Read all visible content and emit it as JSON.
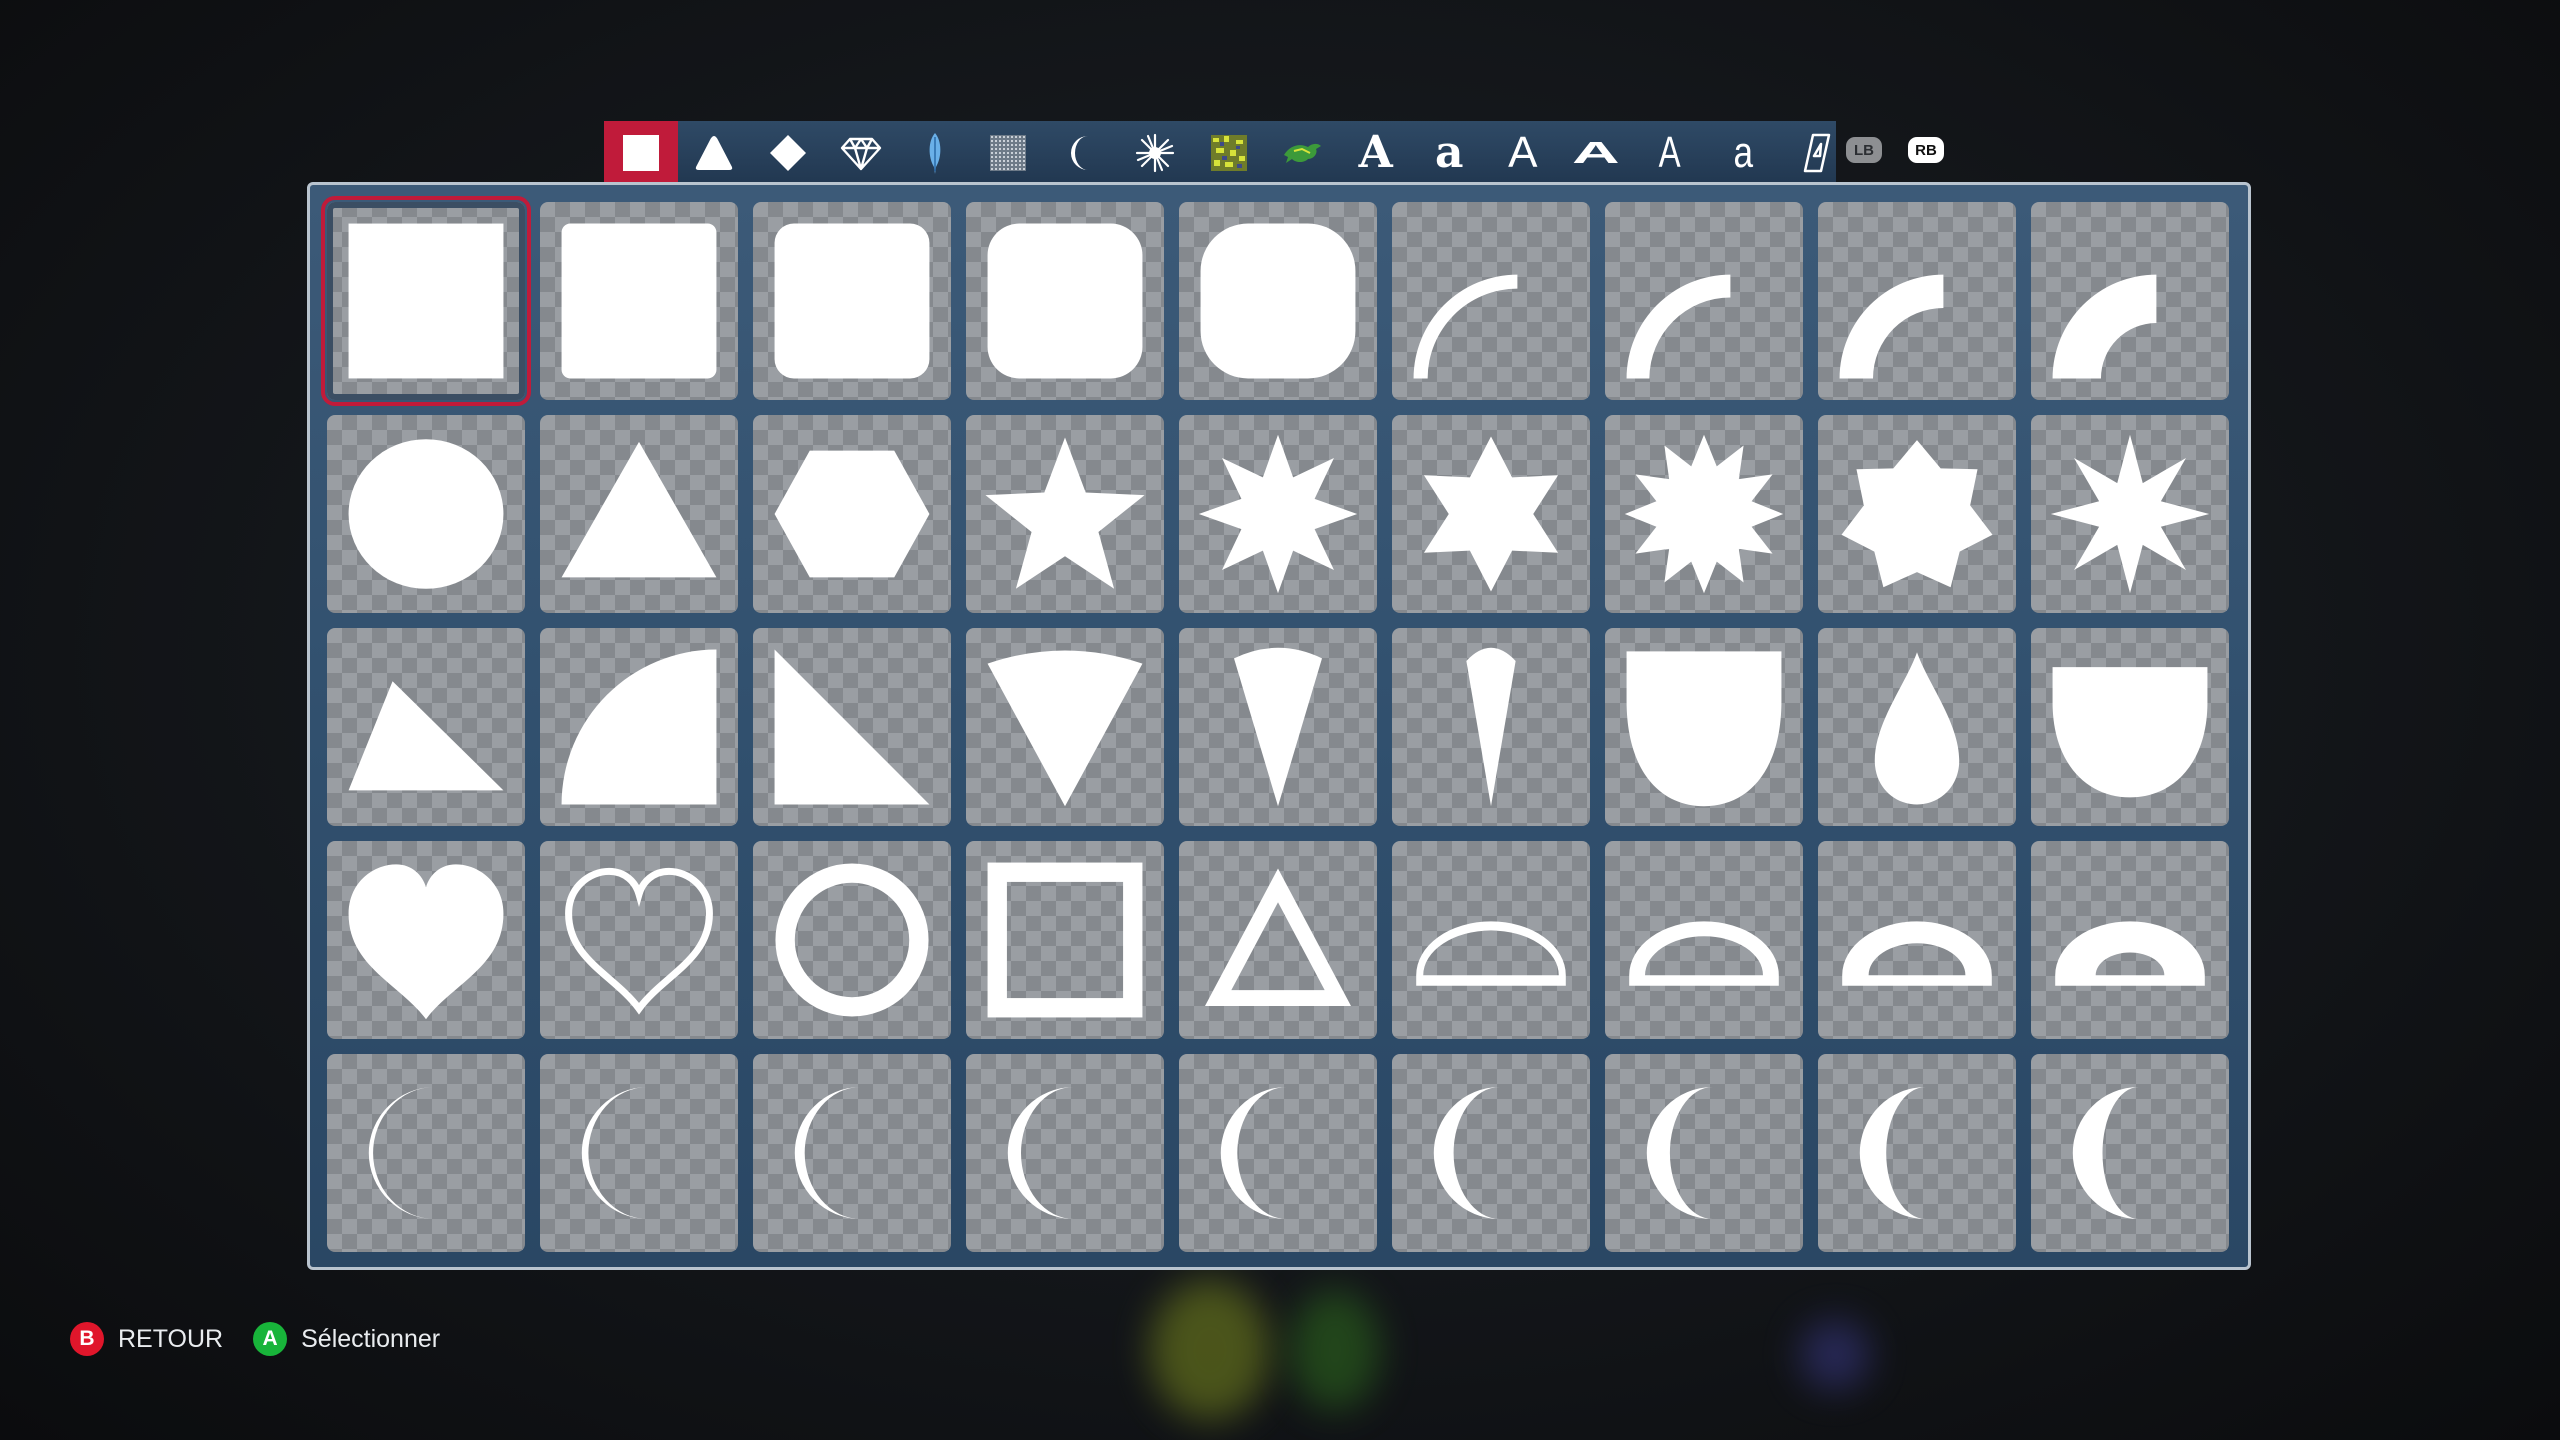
{
  "tabs": [
    {
      "icon": "square-icon",
      "active": true
    },
    {
      "icon": "triangle-icon"
    },
    {
      "icon": "diamond-icon"
    },
    {
      "icon": "gem-icon"
    },
    {
      "icon": "feather-icon"
    },
    {
      "icon": "texture-icon"
    },
    {
      "icon": "crescent-icon"
    },
    {
      "icon": "splash-icon"
    },
    {
      "icon": "pattern-icon"
    },
    {
      "icon": "dragon-icon"
    },
    {
      "icon": "font-gothic-icon",
      "glyph": "A"
    },
    {
      "icon": "font-blackletter-icon",
      "glyph": "a"
    },
    {
      "icon": "font-sans-icon",
      "glyph": "A"
    },
    {
      "icon": "font-wide-icon",
      "glyph": "A"
    },
    {
      "icon": "font-narrow-icon",
      "glyph": "A"
    },
    {
      "icon": "font-lower-icon",
      "glyph": "a"
    },
    {
      "icon": "font-outline-icon",
      "glyph": "A"
    }
  ],
  "bumpers": {
    "left": "LB",
    "right": "RB"
  },
  "grid": {
    "rows": 5,
    "cols": 9,
    "selected_index": 0,
    "shapes": [
      "square-sharp-shape",
      "square-rounded-1-shape",
      "square-rounded-2-shape",
      "square-rounded-3-shape",
      "square-rounded-4-shape",
      "arc-thin-shape",
      "arc-medium-shape",
      "arc-thick-shape",
      "arc-thickest-shape",
      "circle-shape",
      "triangle-shape",
      "hexagon-shape",
      "star-5-shape",
      "star-8-shape",
      "star-6-shape",
      "star-12-shape",
      "star-7-shape",
      "star-8-sharp-shape",
      "right-triangle-obtuse-shape",
      "quarter-circle-shape",
      "right-triangle-shape",
      "wedge-wide-shape",
      "wedge-narrow-shape",
      "spike-shape",
      "shield-shape",
      "teardrop-shape",
      "bowl-shape",
      "heart-shape",
      "heart-outline-shape",
      "ring-shape",
      "square-outline-shape",
      "triangle-outline-shape",
      "half-ring-thin-shape",
      "half-ring-medium-shape",
      "half-ring-thick-shape",
      "half-ring-thickest-shape",
      "crescent-1-shape",
      "crescent-2-shape",
      "crescent-3-shape",
      "crescent-4-shape",
      "crescent-5-shape",
      "crescent-6-shape",
      "crescent-7-shape",
      "crescent-8-shape",
      "crescent-9-shape"
    ]
  },
  "footer": {
    "back": {
      "button": "B",
      "label": "RETOUR"
    },
    "select": {
      "button": "A",
      "label": "Sélectionner"
    }
  }
}
